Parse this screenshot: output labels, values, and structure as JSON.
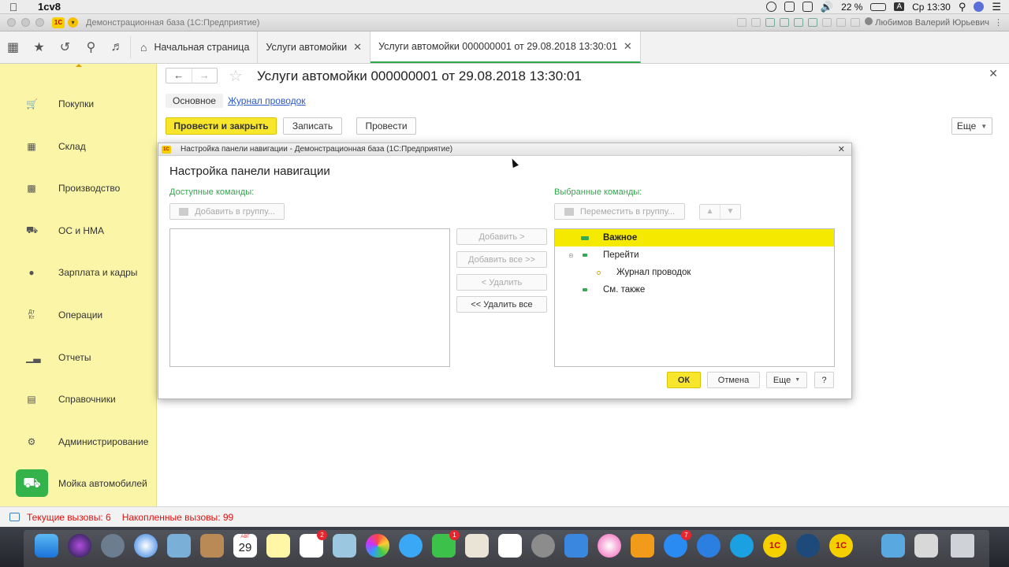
{
  "menubar": {
    "app_name": "1cv8",
    "battery": "22 %",
    "clock": "Ср 13:30",
    "input_lang": "A"
  },
  "window": {
    "title": "Демонстрационная база  (1С:Предприятие)",
    "user": "Любимов Валерий Юрьевич"
  },
  "tabs": [
    {
      "label": "Начальная страница",
      "closable": false
    },
    {
      "label": "Услуги автомойки",
      "closable": true
    },
    {
      "label": "Услуги автомойки 000000001 от 29.08.2018 13:30:01",
      "closable": true
    }
  ],
  "sidebar": {
    "items": [
      {
        "label": "Покупки",
        "icon": "cart-icon"
      },
      {
        "label": "Склад",
        "icon": "warehouse-icon"
      },
      {
        "label": "Производство",
        "icon": "factory-icon"
      },
      {
        "label": "ОС и НМА",
        "icon": "truck-icon"
      },
      {
        "label": "Зарплата и кадры",
        "icon": "person-icon"
      },
      {
        "label": "Операции",
        "icon": "debit-credit-icon"
      },
      {
        "label": "Отчеты",
        "icon": "bar-chart-icon"
      },
      {
        "label": "Справочники",
        "icon": "books-icon"
      },
      {
        "label": "Администрирование",
        "icon": "gear-icon"
      },
      {
        "label": "Мойка автомобилей",
        "icon": "car-wash-icon"
      }
    ]
  },
  "document": {
    "title": "Услуги автомойки 000000001 от 29.08.2018 13:30:01",
    "subtab_main": "Основное",
    "subtab_link": "Журнал проводок",
    "btn_post_close": "Провести и закрыть",
    "btn_save": "Записать",
    "btn_post": "Провести",
    "btn_more": "Еще"
  },
  "dialog": {
    "window_title": "Настройка панели навигации - Демонстрационная база  (1С:Предприятие)",
    "heading": "Настройка панели навигации",
    "available_label": "Доступные команды:",
    "selected_label": "Выбранные команды:",
    "btn_add_to_group": "Добавить в группу...",
    "btn_move_to_group": "Переместить в группу...",
    "btn_add": "Добавить >",
    "btn_add_all": "Добавить все >>",
    "btn_remove": "< Удалить",
    "btn_remove_all": "<< Удалить все",
    "selected_tree": [
      {
        "label": "Важное",
        "level": 0,
        "selected": true
      },
      {
        "label": "Перейти",
        "level": 0,
        "expanded": true
      },
      {
        "label": "Журнал проводок",
        "level": 1
      },
      {
        "label": "См. также",
        "level": 0
      }
    ],
    "btn_ok": "ОК",
    "btn_cancel": "Отмена",
    "btn_more": "Еще",
    "btn_help": "?"
  },
  "status": {
    "current_calls": "Текущие вызовы: 6",
    "accumulated_calls": "Накопленные вызовы: 99"
  },
  "dock": {
    "calendar_month": "АВГ",
    "calendar_day": "29",
    "reminders_badge": "2",
    "facetime_badge": "1",
    "appstore_badge": "7",
    "logo_text": "1С"
  },
  "colors": {
    "sidebar_bg": "#fbf6a7",
    "accent_yellow": "#f8e62d",
    "accent_green": "#2fa84a",
    "status_red": "#dd1111",
    "link_blue": "#2a58c8"
  }
}
